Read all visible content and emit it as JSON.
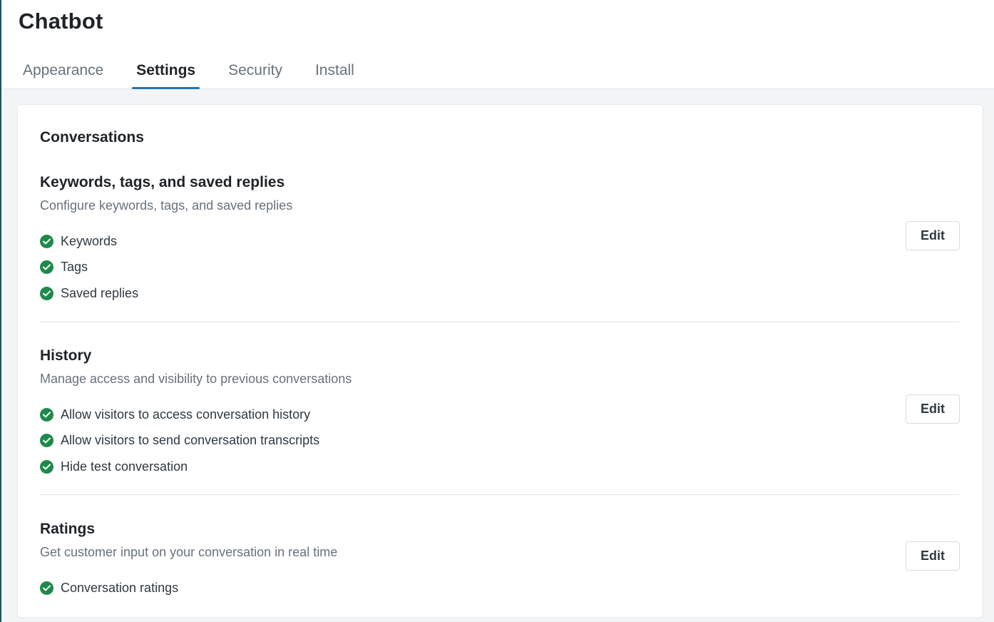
{
  "header": {
    "title": "Chatbot",
    "tabs": [
      {
        "label": "Appearance",
        "active": false
      },
      {
        "label": "Settings",
        "active": true
      },
      {
        "label": "Security",
        "active": false
      },
      {
        "label": "Install",
        "active": false
      }
    ]
  },
  "card": {
    "title": "Conversations",
    "sections": [
      {
        "title": "Keywords, tags, and saved replies",
        "description": "Configure keywords, tags, and saved replies",
        "items": [
          "Keywords",
          "Tags",
          "Saved replies"
        ],
        "edit_label": "Edit"
      },
      {
        "title": "History",
        "description": "Manage access and visibility to previous conversations",
        "items": [
          "Allow visitors to access conversation history",
          "Allow visitors to send conversation transcripts",
          "Hide test conversation"
        ],
        "edit_label": "Edit"
      },
      {
        "title": "Ratings",
        "description": "Get customer input on your conversation in real time",
        "items": [
          "Conversation ratings"
        ],
        "edit_label": "Edit"
      }
    ]
  },
  "colors": {
    "accent": "#1f73b7",
    "check": "#1e8a4a",
    "muted_text": "#68717c"
  },
  "icons": {
    "status": "check-circle-icon"
  }
}
